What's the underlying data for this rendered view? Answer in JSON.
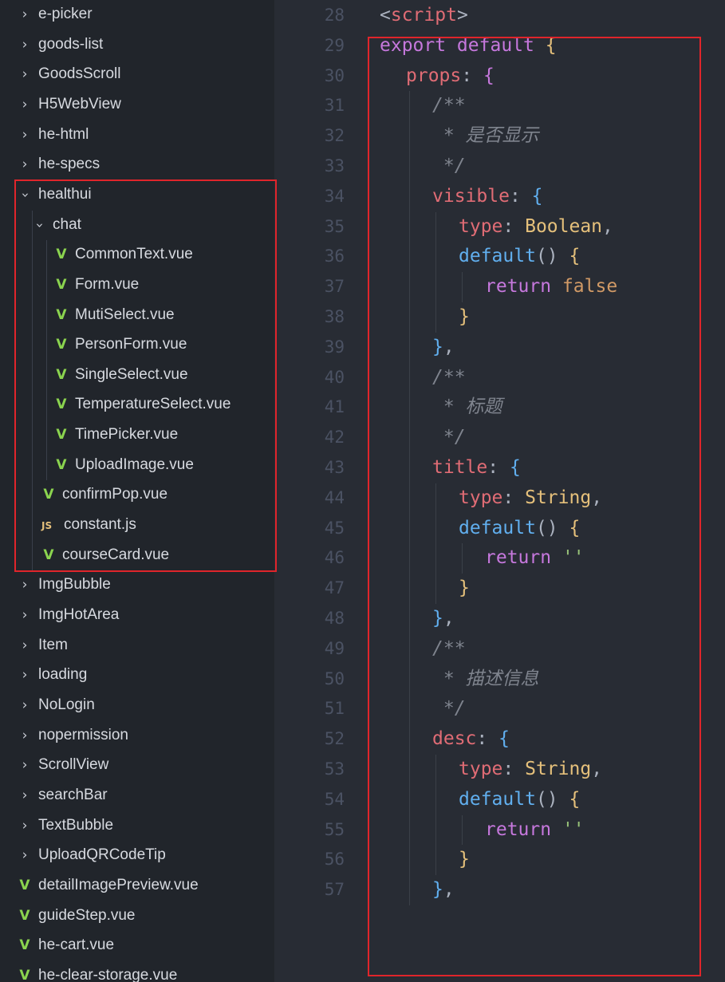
{
  "colors": {
    "sidebar_bg": "#21252b",
    "editor_bg": "#282c34",
    "highlight_box": "#e0252b",
    "keyword": "#c678dd",
    "property": "#e06c75",
    "type_name": "#e5c07b",
    "function": "#61afef",
    "string": "#98c379",
    "comment": "#7f848e",
    "punctuation": "#abb2bf",
    "constant": "#d19a66",
    "tag": "#e06c75"
  },
  "sidebar": {
    "items": [
      {
        "kind": "folder",
        "open": false,
        "level": 0,
        "icon": "chevron-right-icon",
        "label": "e-picker"
      },
      {
        "kind": "folder",
        "open": false,
        "level": 0,
        "icon": "chevron-right-icon",
        "label": "goods-list"
      },
      {
        "kind": "folder",
        "open": false,
        "level": 0,
        "icon": "chevron-right-icon",
        "label": "GoodsScroll"
      },
      {
        "kind": "folder",
        "open": false,
        "level": 0,
        "icon": "chevron-right-icon",
        "label": "H5WebView"
      },
      {
        "kind": "folder",
        "open": false,
        "level": 0,
        "icon": "chevron-right-icon",
        "label": "he-html"
      },
      {
        "kind": "folder",
        "open": false,
        "level": 0,
        "icon": "chevron-right-icon",
        "label": "he-specs"
      },
      {
        "kind": "folder",
        "open": true,
        "level": 0,
        "icon": "chevron-down-icon",
        "label": "healthui"
      },
      {
        "kind": "folder",
        "open": true,
        "level": 1,
        "icon": "chevron-down-icon",
        "label": "chat"
      },
      {
        "kind": "vue",
        "level": 2,
        "icon": "vue-file-icon",
        "label": "CommonText.vue"
      },
      {
        "kind": "vue",
        "level": 2,
        "icon": "vue-file-icon",
        "label": "Form.vue"
      },
      {
        "kind": "vue",
        "level": 2,
        "icon": "vue-file-icon",
        "label": "MutiSelect.vue"
      },
      {
        "kind": "vue",
        "level": 2,
        "icon": "vue-file-icon",
        "label": "PersonForm.vue"
      },
      {
        "kind": "vue",
        "level": 2,
        "icon": "vue-file-icon",
        "label": "SingleSelect.vue"
      },
      {
        "kind": "vue",
        "level": 2,
        "icon": "vue-file-icon",
        "label": "TemperatureSelect.vue"
      },
      {
        "kind": "vue",
        "level": 2,
        "icon": "vue-file-icon",
        "label": "TimePicker.vue"
      },
      {
        "kind": "vue",
        "level": 2,
        "icon": "vue-file-icon",
        "label": "UploadImage.vue"
      },
      {
        "kind": "vue",
        "level": 1,
        "icon": "vue-file-icon",
        "label": "confirmPop.vue"
      },
      {
        "kind": "js",
        "level": 1,
        "icon": "js-file-icon",
        "icon_text": "JS",
        "label": "constant.js"
      },
      {
        "kind": "vue",
        "level": 1,
        "icon": "vue-file-icon",
        "label": "courseCard.vue"
      },
      {
        "kind": "folder",
        "open": false,
        "level": 0,
        "icon": "chevron-right-icon",
        "label": "ImgBubble"
      },
      {
        "kind": "folder",
        "open": false,
        "level": 0,
        "icon": "chevron-right-icon",
        "label": "ImgHotArea"
      },
      {
        "kind": "folder",
        "open": false,
        "level": 0,
        "icon": "chevron-right-icon",
        "label": "Item"
      },
      {
        "kind": "folder",
        "open": false,
        "level": 0,
        "icon": "chevron-right-icon",
        "label": "loading"
      },
      {
        "kind": "folder",
        "open": false,
        "level": 0,
        "icon": "chevron-right-icon",
        "label": "NoLogin"
      },
      {
        "kind": "folder",
        "open": false,
        "level": 0,
        "icon": "chevron-right-icon",
        "label": "nopermission"
      },
      {
        "kind": "folder",
        "open": false,
        "level": 0,
        "icon": "chevron-right-icon",
        "label": "ScrollView"
      },
      {
        "kind": "folder",
        "open": false,
        "level": 0,
        "icon": "chevron-right-icon",
        "label": "searchBar"
      },
      {
        "kind": "folder",
        "open": false,
        "level": 0,
        "icon": "chevron-right-icon",
        "label": "TextBubble"
      },
      {
        "kind": "folder",
        "open": false,
        "level": 0,
        "icon": "chevron-right-icon",
        "label": "UploadQRCodeTip"
      },
      {
        "kind": "vue",
        "level": 0,
        "icon": "vue-file-icon",
        "label": "detailImagePreview.vue"
      },
      {
        "kind": "vue",
        "level": 0,
        "icon": "vue-file-icon",
        "label": "guideStep.vue"
      },
      {
        "kind": "vue",
        "level": 0,
        "icon": "vue-file-icon",
        "label": "he-cart.vue"
      },
      {
        "kind": "vue",
        "level": 0,
        "icon": "vue-file-icon",
        "label": "he-clear-storage.vue"
      }
    ]
  },
  "editor": {
    "lines": [
      {
        "n": "28",
        "indent": 0,
        "tokens": [
          [
            "punctuation",
            "<"
          ],
          [
            "tag",
            "script"
          ],
          [
            "punctuation",
            ">"
          ]
        ]
      },
      {
        "n": "29",
        "indent": 0,
        "tokens": [
          [
            "keyword",
            "export default "
          ],
          [
            "type_name",
            "{"
          ]
        ]
      },
      {
        "n": "30",
        "indent": 1,
        "tokens": [
          [
            "property",
            "props"
          ],
          [
            "punctuation",
            ": "
          ],
          [
            "keyword",
            "{"
          ]
        ]
      },
      {
        "n": "31",
        "indent": 2,
        "tokens": [
          [
            "comment",
            "/**"
          ]
        ]
      },
      {
        "n": "32",
        "indent": 2,
        "tokens": [
          [
            "comment",
            " * 是否显示"
          ]
        ]
      },
      {
        "n": "33",
        "indent": 2,
        "tokens": [
          [
            "comment",
            " */"
          ]
        ]
      },
      {
        "n": "34",
        "indent": 2,
        "tokens": [
          [
            "property",
            "visible"
          ],
          [
            "punctuation",
            ": "
          ],
          [
            "function",
            "{"
          ]
        ]
      },
      {
        "n": "35",
        "indent": 3,
        "tokens": [
          [
            "property",
            "type"
          ],
          [
            "punctuation",
            ": "
          ],
          [
            "type_name",
            "Boolean"
          ],
          [
            "punctuation",
            ","
          ]
        ]
      },
      {
        "n": "36",
        "indent": 3,
        "tokens": [
          [
            "function",
            "default"
          ],
          [
            "punctuation",
            "() "
          ],
          [
            "type_name",
            "{"
          ]
        ]
      },
      {
        "n": "37",
        "indent": 4,
        "tokens": [
          [
            "keyword",
            "return "
          ],
          [
            "constant",
            "false"
          ]
        ]
      },
      {
        "n": "38",
        "indent": 3,
        "tokens": [
          [
            "type_name",
            "}"
          ]
        ]
      },
      {
        "n": "39",
        "indent": 2,
        "tokens": [
          [
            "function",
            "}"
          ],
          [
            "punctuation",
            ","
          ]
        ]
      },
      {
        "n": "40",
        "indent": 2,
        "tokens": [
          [
            "comment",
            "/**"
          ]
        ]
      },
      {
        "n": "41",
        "indent": 2,
        "tokens": [
          [
            "comment",
            " * 标题"
          ]
        ]
      },
      {
        "n": "42",
        "indent": 2,
        "tokens": [
          [
            "comment",
            " */"
          ]
        ]
      },
      {
        "n": "43",
        "indent": 2,
        "tokens": [
          [
            "property",
            "title"
          ],
          [
            "punctuation",
            ": "
          ],
          [
            "function",
            "{"
          ]
        ]
      },
      {
        "n": "44",
        "indent": 3,
        "tokens": [
          [
            "property",
            "type"
          ],
          [
            "punctuation",
            ": "
          ],
          [
            "type_name",
            "String"
          ],
          [
            "punctuation",
            ","
          ]
        ]
      },
      {
        "n": "45",
        "indent": 3,
        "tokens": [
          [
            "function",
            "default"
          ],
          [
            "punctuation",
            "() "
          ],
          [
            "type_name",
            "{"
          ]
        ]
      },
      {
        "n": "46",
        "indent": 4,
        "tokens": [
          [
            "keyword",
            "return "
          ],
          [
            "string",
            "''"
          ]
        ]
      },
      {
        "n": "47",
        "indent": 3,
        "tokens": [
          [
            "type_name",
            "}"
          ]
        ]
      },
      {
        "n": "48",
        "indent": 2,
        "tokens": [
          [
            "function",
            "}"
          ],
          [
            "punctuation",
            ","
          ]
        ]
      },
      {
        "n": "49",
        "indent": 2,
        "tokens": [
          [
            "comment",
            "/**"
          ]
        ]
      },
      {
        "n": "50",
        "indent": 2,
        "tokens": [
          [
            "comment",
            " * 描述信息"
          ]
        ]
      },
      {
        "n": "51",
        "indent": 2,
        "tokens": [
          [
            "comment",
            " */"
          ]
        ]
      },
      {
        "n": "52",
        "indent": 2,
        "tokens": [
          [
            "property",
            "desc"
          ],
          [
            "punctuation",
            ": "
          ],
          [
            "function",
            "{"
          ]
        ]
      },
      {
        "n": "53",
        "indent": 3,
        "tokens": [
          [
            "property",
            "type"
          ],
          [
            "punctuation",
            ": "
          ],
          [
            "type_name",
            "String"
          ],
          [
            "punctuation",
            ","
          ]
        ]
      },
      {
        "n": "54",
        "indent": 3,
        "tokens": [
          [
            "function",
            "default"
          ],
          [
            "punctuation",
            "() "
          ],
          [
            "type_name",
            "{"
          ]
        ]
      },
      {
        "n": "55",
        "indent": 4,
        "tokens": [
          [
            "keyword",
            "return "
          ],
          [
            "string",
            "''"
          ]
        ]
      },
      {
        "n": "56",
        "indent": 3,
        "tokens": [
          [
            "type_name",
            "}"
          ]
        ]
      },
      {
        "n": "57",
        "indent": 2,
        "tokens": [
          [
            "function",
            "}"
          ],
          [
            "punctuation",
            ","
          ]
        ]
      }
    ]
  }
}
